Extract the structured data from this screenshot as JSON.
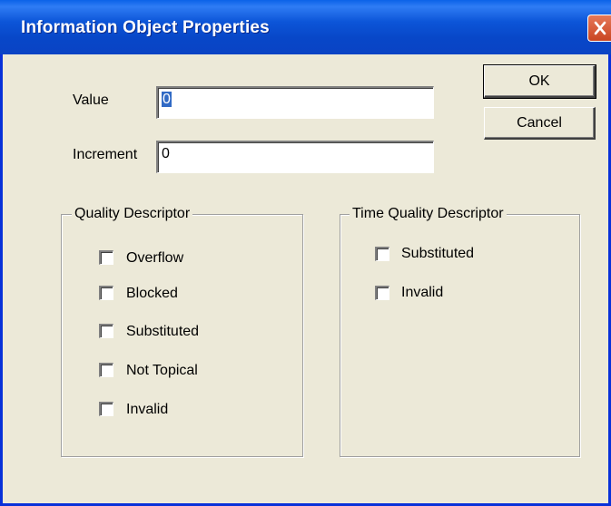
{
  "window": {
    "title": "Information Object Properties"
  },
  "fields": {
    "value_label": "Value",
    "value": "0",
    "increment_label": "Increment",
    "increment": "0"
  },
  "buttons": {
    "ok": "OK",
    "cancel": "Cancel"
  },
  "quality_descriptor": {
    "title": "Quality Descriptor",
    "items": [
      "Overflow",
      "Blocked",
      "Substituted",
      "Not Topical",
      "Invalid"
    ]
  },
  "time_quality_descriptor": {
    "title": "Time Quality Descriptor",
    "items": [
      "Substituted",
      "Invalid"
    ]
  },
  "colors": {
    "titlebar": "#0a4fd4",
    "dialog_bg": "#ece9d8",
    "close_button": "#d9532e",
    "selection": "#316ac5"
  }
}
